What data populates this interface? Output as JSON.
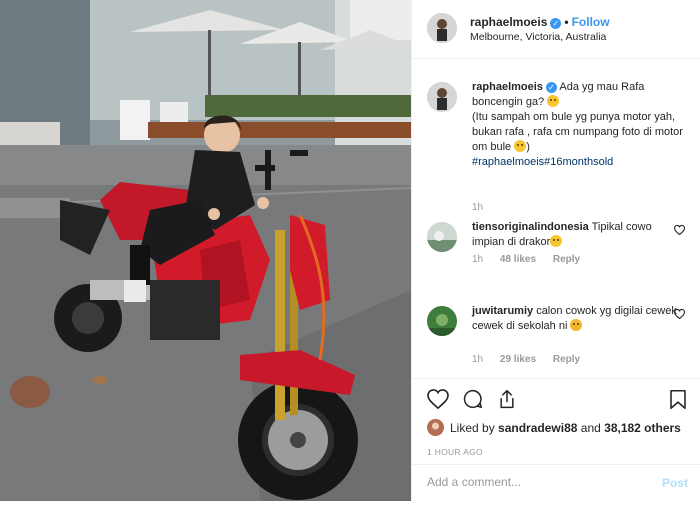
{
  "post": {
    "username": "raphaelmoeis",
    "verified_icon": "verified-badge-icon",
    "dot": "•",
    "follow_label": "Follow",
    "location": "Melbourne, Victoria, Australia"
  },
  "caption": {
    "username": "raphaelmoeis",
    "line1": "Ada yg mau Rafa boncengin ga?",
    "line2": "(Itu sampah om bule yg punya motor yah, bukan rafa , rafa cm numpang foto di motor om bule",
    "line2_end": ")",
    "hashtags": "#raphaelmoeis#16monthsold",
    "time": "1h"
  },
  "comments": [
    {
      "username": "tiensoriginalindonesia",
      "text": "Tipikal cowo impian di drakor",
      "time": "1h",
      "likes": "48 likes",
      "reply": "Reply"
    },
    {
      "username": "juwitarumiy",
      "text": "calon cowok yg digilai cewek cewek di sekolah ni",
      "time": "1h",
      "likes": "29 likes",
      "reply": "Reply"
    }
  ],
  "actions": {
    "icons": [
      "heart-icon",
      "comment-icon",
      "share-icon",
      "bookmark-icon"
    ],
    "liked_prefix": "Liked by",
    "liked_user": "sandradewi88",
    "liked_and": "and",
    "liked_count": "38,182 others",
    "time_ago": "1 HOUR AGO"
  },
  "add_comment": {
    "placeholder": "Add a comment...",
    "post_label": "Post"
  },
  "colors": {
    "link_blue": "#3897f0",
    "hashtag": "#003569",
    "muted": "#999999",
    "post_disabled": "#b2dffc",
    "bike_red": "#d11b2a"
  }
}
